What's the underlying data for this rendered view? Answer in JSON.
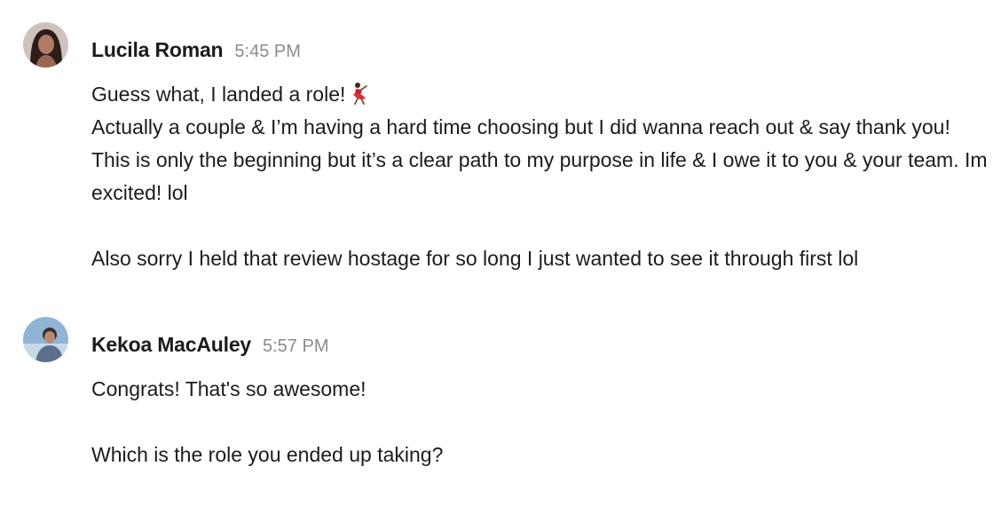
{
  "messages": [
    {
      "sender": "Lucila Roman",
      "time": "5:45 PM",
      "avatar_icon": "user-avatar-photo",
      "lines": [
        "Guess what, I landed a role!",
        "Actually a couple & I’m having a hard time choosing but I did wanna reach out & say thank you! This is only the beginning but it’s a clear path to my purpose in life & I owe it to you & your team. Im excited! lol",
        "Also sorry I held that review hostage for so long I just wanted to see it through first lol"
      ],
      "emoji": "dancer-emoji"
    },
    {
      "sender": "Kekoa MacAuley",
      "time": "5:57 PM",
      "avatar_icon": "user-avatar-photo",
      "lines": [
        "Congrats! That's so awesome!",
        "Which is the role you ended up taking?"
      ]
    }
  ],
  "colors": {
    "text": "#1d1c1d",
    "timestamp": "#8b8b8b",
    "background": "#ffffff"
  }
}
